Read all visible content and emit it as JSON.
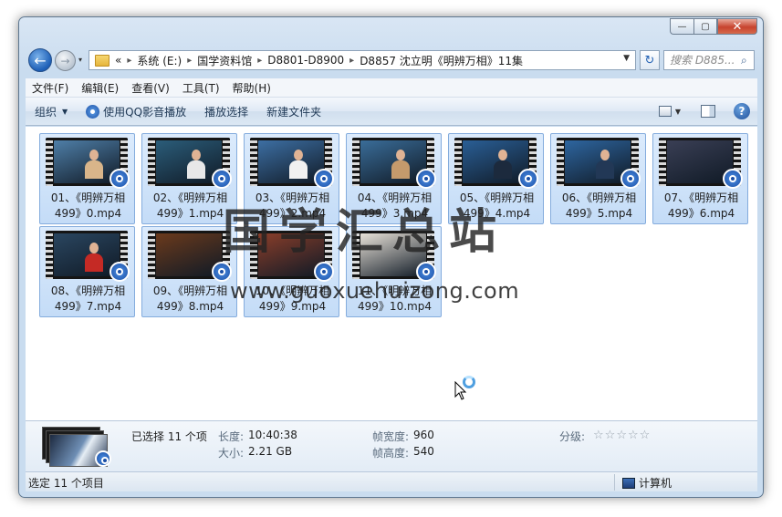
{
  "window": {
    "min_glyph": "—",
    "max_glyph": "▢",
    "close_glyph": "✕"
  },
  "address_bar": {
    "breadcrumbs": [
      "«",
      "系统 (E:)",
      "国学资料馆",
      "D8801-D8900",
      "D8857 沈立明《明辨万相》11集"
    ],
    "search_placeholder": "搜索 D885..."
  },
  "menu": [
    "文件(F)",
    "编辑(E)",
    "查看(V)",
    "工具(T)",
    "帮助(H)"
  ],
  "toolbar": {
    "organize": "组织",
    "play_qq": "使用QQ影音播放",
    "play_selection": "播放选择",
    "new_folder": "新建文件夹"
  },
  "files": [
    {
      "line1": "01、《明辨万相",
      "line2": "499》0.mp4",
      "scene": "#4f7fa8",
      "body": "#d9b58a"
    },
    {
      "line1": "02、《明辨万相",
      "line2": "499》1.mp4",
      "scene": "#2b5d7a",
      "body": "#e8e8e8"
    },
    {
      "line1": "03、《明辨万相",
      "line2": "499》2.mp4",
      "scene": "#3d6fa3",
      "body": "#f1f1f1"
    },
    {
      "line1": "04、《明辨万相",
      "line2": "499》3.mp4",
      "scene": "#3a6d99",
      "body": "#c49a6c"
    },
    {
      "line1": "05、《明辨万相",
      "line2": "499》4.mp4",
      "scene": "#2a5f96",
      "body": "#1c2a3d"
    },
    {
      "line1": "06、《明辨万相",
      "line2": "499》5.mp4",
      "scene": "#2e66a0",
      "body": "#223856"
    },
    {
      "line1": "07、《明辨万相",
      "line2": "499》6.mp4",
      "scene": "#3a3f55",
      "body": ""
    },
    {
      "line1": "08、《明辨万相",
      "line2": "499》7.mp4",
      "scene": "#2a4660",
      "body": "#c52a25"
    },
    {
      "line1": "09、《明辨万相",
      "line2": "499》8.mp4",
      "scene": "#6b3a1c",
      "body": ""
    },
    {
      "line1": "10、《明辨万相",
      "line2": "499》9.mp4",
      "scene": "#8a3e2a",
      "body": ""
    },
    {
      "line1": "11、《明辨万相",
      "line2": "499》10.mp4",
      "scene": "#e8e2d8",
      "body": ""
    }
  ],
  "watermark": {
    "text": "国学汇总站",
    "url": "www.guoxuehuizong.com"
  },
  "details": {
    "selected": "已选择 11 个项",
    "length_label": "长度:",
    "length_value": "10:40:38",
    "size_label": "大小:",
    "size_value": "2.21 GB",
    "width_label": "帧宽度:",
    "width_value": "960",
    "height_label": "帧高度:",
    "height_value": "540",
    "rating_label": "分级:",
    "rating_value": 0,
    "rating_max": 5
  },
  "status": {
    "left": "选定 11 个项目",
    "right": "计算机"
  }
}
